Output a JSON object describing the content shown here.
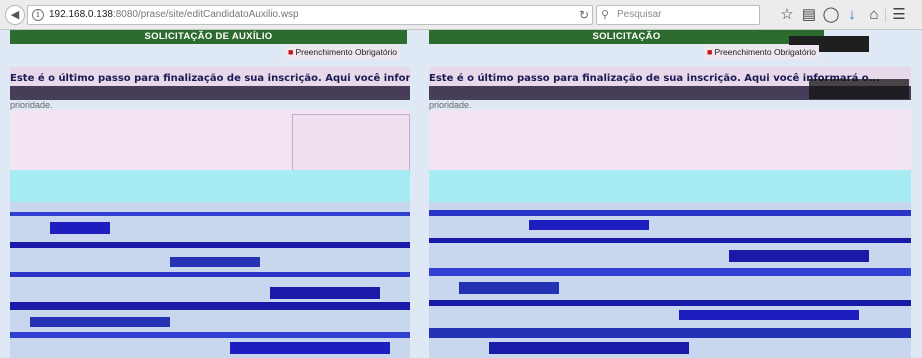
{
  "browser": {
    "back_icon": "back-arrow-icon",
    "url_host": "192.168.0.138",
    "url_rest": ":8080/prase/site/editCandidatoAuxilio.wsp",
    "search_placeholder": "Pesquisar",
    "toolbar_icons": [
      "star-icon",
      "bookmark-list-icon",
      "pocket-icon",
      "download-icon",
      "home-icon",
      "menu-icon"
    ]
  },
  "page": {
    "section_title_left": "SOLICITAÇÃO DE AUXÍLIO",
    "section_title_right": "SOLICITAÇÃO",
    "required_note": "Preenchimento Obrigatório",
    "intro_left": "Este é o último passo para finalização de sua inscrição. Aqui você informará os ...",
    "intro_right": "Este é o último passo para finalização de sua inscrição. Aqui você informará o...",
    "continuation_left": "prioridade.",
    "continuation_right": "prioridade.",
    "colors": {
      "section_bar": "#2e6b2e",
      "required_dot": "#c3161c",
      "page_bg": "#dfe9f5"
    }
  }
}
